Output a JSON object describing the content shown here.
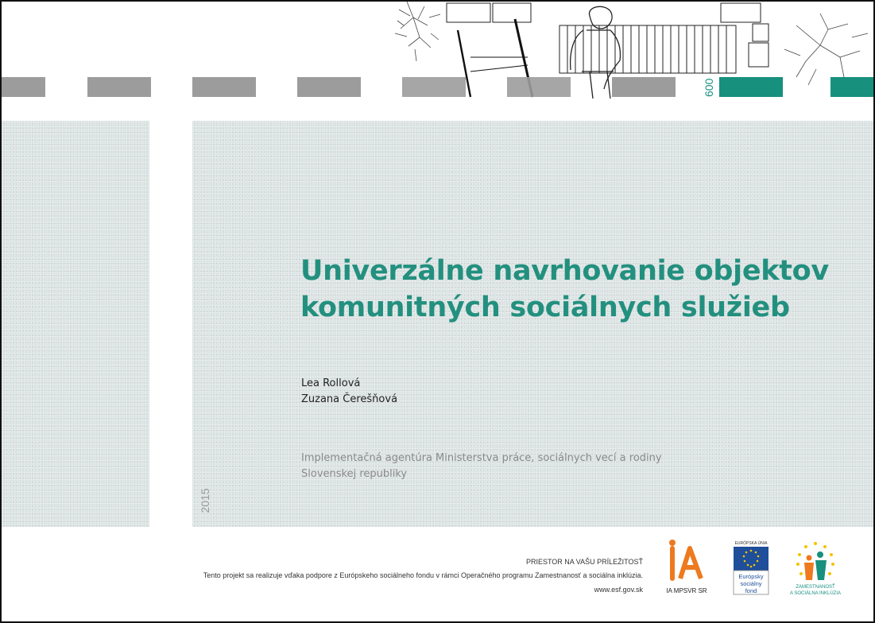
{
  "header": {
    "sign_text": "600"
  },
  "document": {
    "title_line1": "Univerzálne navrhovanie objektov",
    "title_line2": "komunitných sociálnych služieb",
    "authors": [
      "Lea Rollová",
      "Zuzana Čerešňová"
    ],
    "institution_line1": "Implementačná agentúra Ministerstva práce, sociálnych vecí a rodiny",
    "institution_line2": "Slovenskej republiky",
    "year": "2015"
  },
  "footer": {
    "slogan": "PRIESTOR NA VAŠU PRÍLEŽITOSŤ",
    "support_text": "Tento projekt sa realizuje vďaka podpore z Európskeho sociálneho fondu v rámci Operačného programu Zamestnanosť a sociálna inklúzia.",
    "url": "www.esf.gov.sk"
  },
  "logos": {
    "ia": {
      "letters": "iA",
      "caption": "IA MPSVR SR"
    },
    "eu": {
      "top": "EURÓPSKA ÚNIA",
      "line1": "Európsky",
      "line2": "sociálny",
      "line3": "fond"
    },
    "zsi": {
      "line1": "ZAMESTNANOSŤ",
      "line2": "A SOCIÁLNA INKLÚZIA"
    }
  },
  "colors": {
    "teal": "#17907e",
    "gray_bar": "#9c9c9c",
    "panel": "#dde4e4",
    "ia_orange": "#ee7a1f",
    "eu_blue": "#1f4e9a",
    "eu_yellow": "#f3c300"
  }
}
